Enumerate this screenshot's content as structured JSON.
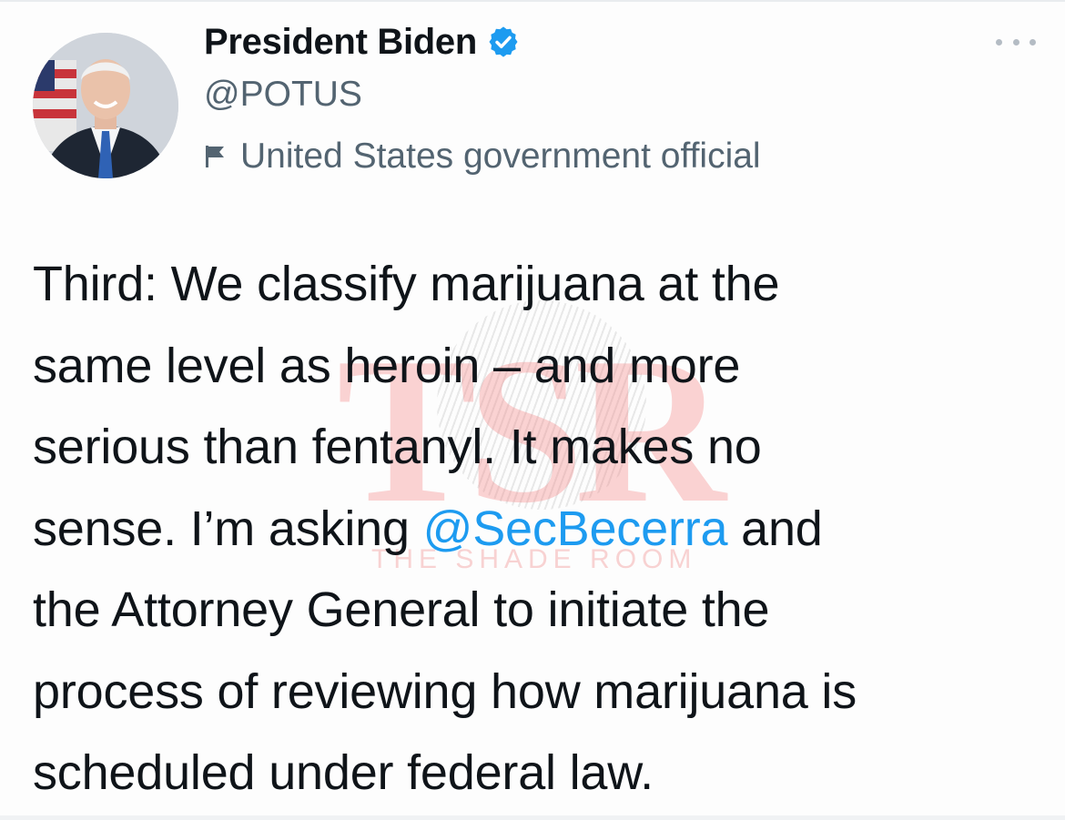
{
  "author": {
    "display_name": "President Biden",
    "handle": "@POTUS",
    "label": "United States government official",
    "verified_color": "#1d9bf0"
  },
  "tweet": {
    "lines": [
      "Third: We classify marijuana at the",
      "same level as heroin – and more",
      "serious than fentanyl. It makes no"
    ],
    "line4_before": "sense. I’m asking ",
    "mention": "@SecBecerra",
    "line4_after": " and",
    "lines_end": [
      "the Attorney General to initiate the",
      "process of reviewing how marijuana is",
      "scheduled under federal law."
    ]
  },
  "watermark": {
    "letters": "TSR",
    "subtitle": "THE SHADE ROOM"
  },
  "icons": {
    "verified": "verified-badge-icon",
    "label_flag": "government-flag-icon",
    "more": "more-icon"
  },
  "colors": {
    "text": "#0f1419",
    "secondary": "#536471",
    "link": "#1d9bf0"
  }
}
